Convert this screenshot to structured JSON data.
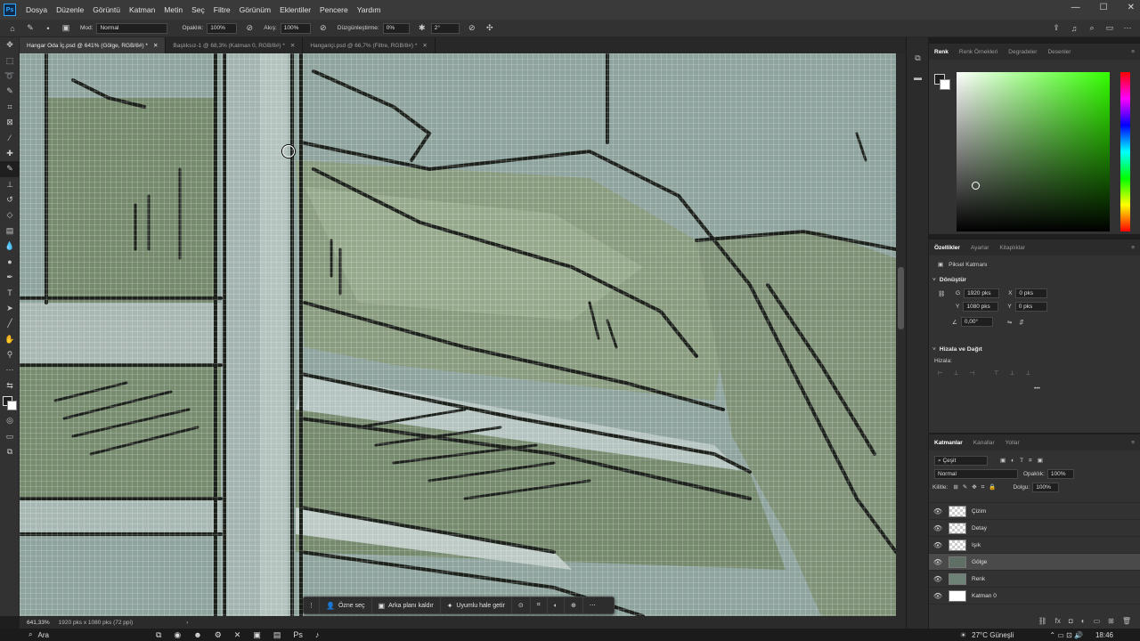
{
  "app": {
    "logo": "Ps"
  },
  "menu": [
    "Dosya",
    "Düzenle",
    "Görüntü",
    "Katman",
    "Metin",
    "Seç",
    "Filtre",
    "Görünüm",
    "Eklentiler",
    "Pencere",
    "Yardım"
  ],
  "window_controls": {
    "minimize": "—",
    "maximize": "☐",
    "close": "✕"
  },
  "options": {
    "mode_label": "Mod:",
    "mode_value": "Normal",
    "opacity_label": "Opaklık:",
    "opacity_value": "100%",
    "flow_label": "Akış:",
    "flow_value": "100%",
    "smoothing_label": "Düzgünleştirme:",
    "smoothing_value": "0%",
    "angle_value": "2°"
  },
  "tabs": [
    {
      "label": "Hangar Oda İç.psd @ 641% (Gölge, RGB/8#) *",
      "active": true
    },
    {
      "label": "Başlıksız-1 @ 68,3% (Katman 0, RGB/8#) *",
      "active": false
    },
    {
      "label": "Hangariçi.psd @ 66,7% (Filtre, RGB/8#) *",
      "active": false
    }
  ],
  "tools": [
    "move-icon",
    "marquee-icon",
    "lasso-icon",
    "quick-select-icon",
    "crop-icon",
    "frame-icon",
    "eyedropper-icon",
    "healing-icon",
    "brush-icon",
    "stamp-icon",
    "history-brush-icon",
    "eraser-icon",
    "gradient-icon",
    "blur-icon",
    "dodge-icon",
    "pen-icon",
    "type-icon",
    "path-select-icon",
    "line-icon",
    "hand-icon",
    "zoom-icon",
    "more-icon"
  ],
  "contextbar": {
    "select_subject": "Özne seç",
    "remove_bg": "Arka planı kaldır",
    "harmonize": "Uyumlu hale getir"
  },
  "status": {
    "zoom": "641,33%",
    "doc_size": "1920 pks x 1080 pks (72 ppi)"
  },
  "color_panel": {
    "tabs": [
      "Renk",
      "Renk Örnekleri",
      "Degradeler",
      "Desenler"
    ]
  },
  "properties": {
    "tabs": [
      "Özellikler",
      "Ayarlar",
      "Kitaplıklar"
    ],
    "type": "Piksel Katmanı",
    "transform_title": "Dönüştür",
    "w_label": "G",
    "w_value": "1920 pks",
    "h_label": "Y",
    "h_value": "1080 pks",
    "x_label": "X",
    "x_value": "0 pks",
    "y_label": "Y",
    "y_value": "0 pks",
    "angle": "0,00°",
    "align_title": "Hizala ve Dağıt",
    "align_label": "Hizala:"
  },
  "layers_panel": {
    "tabs": [
      "Katmanlar",
      "Kanallar",
      "Yollar"
    ],
    "filter": "Çeşit",
    "blend": "Normal",
    "opacity_label": "Opaklık:",
    "opacity_value": "100%",
    "lock_label": "Kilitle:",
    "fill_label": "Dolgu:",
    "fill_value": "100%",
    "layers": [
      {
        "name": "Çizim",
        "selected": false
      },
      {
        "name": "Detay",
        "selected": false
      },
      {
        "name": "Işık",
        "selected": false
      },
      {
        "name": "Gölge",
        "selected": true
      },
      {
        "name": "Renk",
        "selected": false
      },
      {
        "name": "Katman 0",
        "selected": false
      }
    ]
  },
  "taskbar": {
    "search": "Ara",
    "weather": "27°C Güneşli",
    "time": "18:46"
  }
}
